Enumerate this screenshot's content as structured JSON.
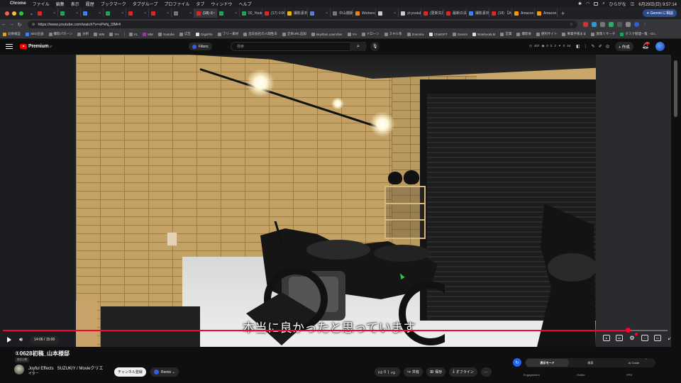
{
  "menubar": {
    "app": "Chrome",
    "items": [
      "ファイル",
      "編集",
      "表示",
      "履歴",
      "ブックマーク",
      "タブグループ",
      "プロファイル",
      "タブ",
      "ウィンドウ",
      "ヘルプ"
    ],
    "input": "ひらがな",
    "datetime": "6月29日(日) 9:57:14"
  },
  "tabs": [
    {
      "label": "",
      "color": "#e02424"
    },
    {
      "label": "",
      "color": "#1ea362"
    },
    {
      "label": "",
      "color": "#3b82f6"
    },
    {
      "label": "",
      "color": "#1ea362"
    },
    {
      "label": "",
      "color": "#e02424"
    },
    {
      "label": "",
      "color": "#e02424"
    },
    {
      "label": "",
      "color": "#777777"
    },
    {
      "label": "(18) ①",
      "color": "#e02424",
      "active": true
    },
    {
      "label": "",
      "color": "#1ea362"
    },
    {
      "label": "02_Youtub",
      "color": "#1ea362"
    },
    {
      "label": "(17) ①06",
      "color": "#e02424"
    },
    {
      "label": "撮影素材",
      "color": "#f4b400"
    },
    {
      "label": "",
      "color": "#5b7bd6"
    },
    {
      "label": "中山徹朗",
      "color": "#777777"
    },
    {
      "label": "Workers",
      "color": "#f38020"
    },
    {
      "label": "",
      "color": "#cccccc"
    },
    {
      "label": "yt-youtub",
      "color": "#cccccc"
    },
    {
      "label": "(更新先行",
      "color": "#e02424"
    },
    {
      "label": "最新の決す",
      "color": "#e02424"
    },
    {
      "label": "撮影素材",
      "color": "#3b82f6"
    },
    {
      "label": "(18) 【Al",
      "color": "#e02424"
    },
    {
      "label": "Amazon.c",
      "color": "#ff9900"
    },
    {
      "label": "Amazon.c",
      "color": "#ff9900"
    }
  ],
  "gemini_button": "Gemini に相談",
  "address": {
    "url": "https://www.youtube.com/watch?v=xPehj_l3Mr4"
  },
  "bookmarks": [
    {
      "label": "効果検証",
      "color": "#e0a030"
    },
    {
      "label": "SEO企画",
      "color": "#3b82f6"
    },
    {
      "label": "撮影パターン",
      "color": "#888888"
    },
    {
      "label": "分析",
      "color": "#888888"
    },
    {
      "label": "WM",
      "color": "#888888"
    },
    {
      "label": "YH",
      "color": "#888888"
    },
    {
      "label": "VL",
      "color": "#888888"
    },
    {
      "label": "MM",
      "color": "#aa33aa"
    },
    {
      "label": "Youtube",
      "color": "#888888"
    },
    {
      "label": "広告",
      "color": "#888888"
    },
    {
      "label": "GigaFile",
      "color": "#dddddd"
    },
    {
      "label": "フリー素材",
      "color": "#888888"
    },
    {
      "label": "出向会社の人間性あ",
      "color": "#888888"
    },
    {
      "label": "全体URL追加",
      "color": "#888888"
    },
    {
      "label": "keyshon Launcher",
      "color": "#888888"
    },
    {
      "label": "YH",
      "color": "#888888"
    },
    {
      "label": "ドローン",
      "color": "#888888"
    },
    {
      "label": "スキル系",
      "color": "#888888"
    },
    {
      "label": "Zoominv",
      "color": "#888888"
    },
    {
      "label": "ChatGPT",
      "color": "#dddddd"
    },
    {
      "label": "Gemini",
      "color": "#888888"
    },
    {
      "label": "NotebookLM",
      "color": "#dddddd"
    },
    {
      "label": "営業",
      "color": "#888888"
    },
    {
      "label": "撮影依",
      "color": "#888888"
    },
    {
      "label": "便利サイト",
      "color": "#888888"
    },
    {
      "label": "事業手帳まま",
      "color": "#888888"
    },
    {
      "label": "施策リサーチ",
      "color": "#888888"
    },
    {
      "label": "タスク管理一覧 - Go...",
      "color": "#1ea362"
    }
  ],
  "yt": {
    "brand": "Premium",
    "region": "JP",
    "filters": "Filters",
    "search_placeholder": "検索",
    "stats": [
      "207",
      "0",
      "0",
      "2",
      "0",
      "44"
    ],
    "create": "+ 作成",
    "notif_count": "9+"
  },
  "video": {
    "subtitle": "本当に良かったと思っています",
    "current": "14:06",
    "duration": "15:00",
    "time_text": "14:06 / 15:00",
    "progress": 0.94
  },
  "below": {
    "title": "①0628初稿_山本様邸",
    "visibility": "限定公開",
    "channel": "Joyful Effects",
    "channel_sub": "イター",
    "subtitle_text": "SUZUKIY / Movieクリエ",
    "subscribe": "チャンネル登録",
    "remix": "Remix",
    "likes": "0",
    "share": "共有",
    "save": "保存",
    "offline": "オフライン"
  },
  "panel": {
    "modes": [
      "表示モード",
      "概要",
      "AI Guide"
    ],
    "labels": [
      "Engagement",
      "Outlier",
      "VPH"
    ]
  },
  "colors": {
    "accent": "#ff0033",
    "yt_red": "#ff0000",
    "bg": "#0f0f0f"
  }
}
